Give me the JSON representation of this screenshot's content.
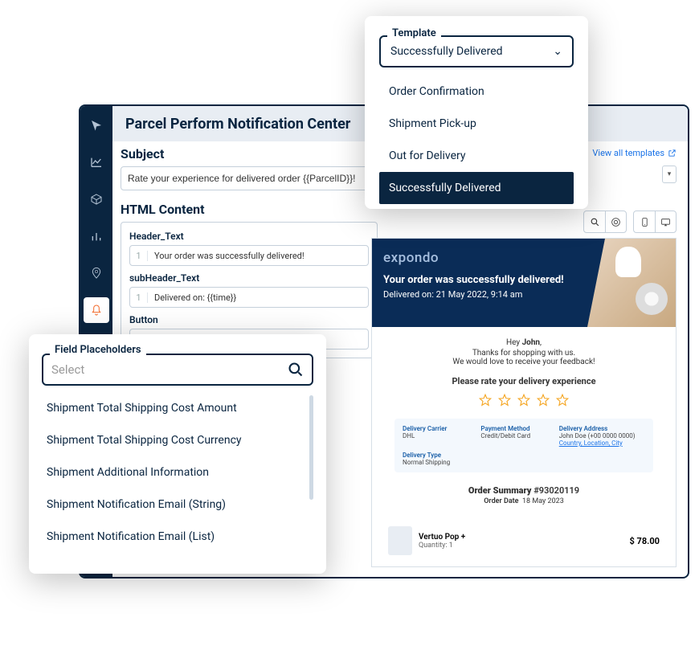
{
  "header": {
    "title": "Parcel Perform Notification Center"
  },
  "subject": {
    "label": "Subject",
    "value": "Rate your experience for delivered order {{ParcelID}}!"
  },
  "htmlContent": {
    "label": "HTML Content",
    "fields": [
      {
        "name": "Header_Text",
        "line": "1",
        "value": "Your order was successfully delivered!"
      },
      {
        "name": "subHeader_Text",
        "line": "1",
        "value": "Delivered on: {{time}}"
      },
      {
        "name": "Button",
        "line": "1",
        "value": ""
      }
    ]
  },
  "topbar": {
    "view_all": "View all templates"
  },
  "template": {
    "legend": "Template",
    "selected": "Successfully Delivered",
    "options": [
      "Order Confirmation",
      "Shipment Pick-up",
      "Out for Delivery",
      "Successfully Delivered"
    ]
  },
  "placeholders": {
    "legend": "Field Placeholders",
    "placeholder": "Select",
    "items": [
      "Shipment Total Shipping Cost Amount",
      "Shipment Total Shipping Cost Currency",
      "Shipment Additional Information",
      "Shipment Notification Email (String)",
      "Shipment Notification Email (List)"
    ]
  },
  "preview": {
    "brand": "expondo",
    "h1": "Your order was successfully delivered!",
    "h2": "Delivered on: 21 May 2022, 9:14 am",
    "hey": "Hey ",
    "hey_name": "John",
    "hey_comma": ",",
    "l1": "Thanks for shopping with us.",
    "l2": "We would love to receive your feedback!",
    "rate": "Please rate your delivery experience",
    "info": {
      "carrier_l": "Delivery Carrier",
      "carrier_v": "DHL",
      "payment_l": "Payment Method",
      "payment_v": "Credit/Debit Card",
      "address_l": "Delivery Address",
      "address_v1": "John Doe (+00 0000 0000)",
      "address_v2": "Country, Location, City",
      "type_l": "Delivery Type",
      "type_v": "Normal Shipping"
    },
    "order": {
      "summary_pre": "Order Summary ",
      "summary_num": "#93020119",
      "date_l": "Order Date",
      "date_v": "18 May 2023"
    },
    "item": {
      "name": "Vertuo Pop +",
      "qty": "Quantity: 1",
      "price": "$ 78.00"
    }
  }
}
